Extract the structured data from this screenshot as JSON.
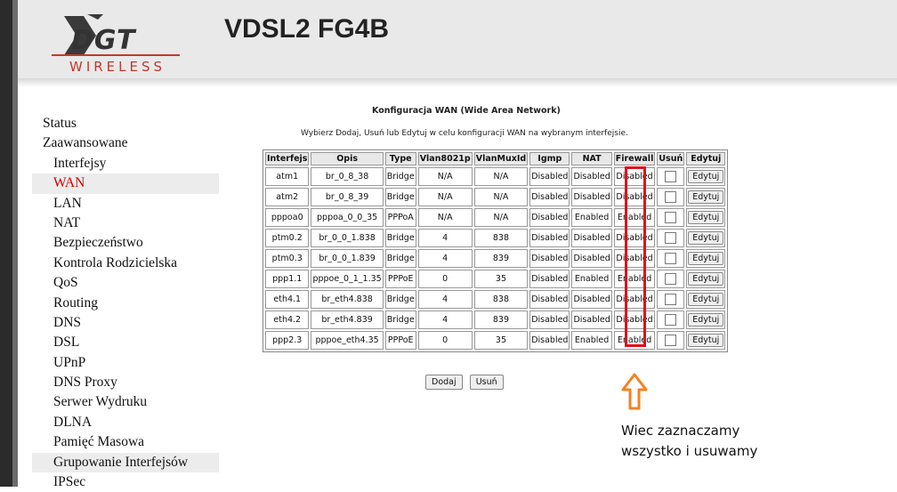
{
  "header": {
    "logo_main": "DGT",
    "logo_sub": "WIRELESS",
    "title": "VDSL2 FG4B"
  },
  "sidebar": {
    "items": [
      {
        "label": "Status",
        "level": "top"
      },
      {
        "label": "Zaawansowane",
        "level": "top"
      },
      {
        "label": "Interfejsy",
        "level": "sub"
      },
      {
        "label": "WAN",
        "level": "sub",
        "active": true
      },
      {
        "label": "LAN",
        "level": "sub"
      },
      {
        "label": "NAT",
        "level": "sub"
      },
      {
        "label": "Bezpieczeństwo",
        "level": "sub"
      },
      {
        "label": "Kontrola Rodzicielska",
        "level": "sub"
      },
      {
        "label": "QoS",
        "level": "sub"
      },
      {
        "label": "Routing",
        "level": "sub"
      },
      {
        "label": "DNS",
        "level": "sub"
      },
      {
        "label": "DSL",
        "level": "sub"
      },
      {
        "label": "UPnP",
        "level": "sub"
      },
      {
        "label": "DNS Proxy",
        "level": "sub"
      },
      {
        "label": "Serwer Wydruku",
        "level": "sub"
      },
      {
        "label": "DLNA",
        "level": "sub"
      },
      {
        "label": "Pamięć Masowa",
        "level": "sub"
      },
      {
        "label": "Grupowanie Interfejsów",
        "level": "sub",
        "highlight": true
      },
      {
        "label": "IPSec",
        "level": "sub"
      }
    ]
  },
  "main": {
    "title": "Konfiguracja WAN (Wide Area Network)",
    "description": "Wybierz Dodaj, Usuń lub Edytuj w celu konfiguracji WAN na wybranym interfejsie.",
    "table": {
      "headers": [
        "Interfejs",
        "Opis",
        "Type",
        "Vlan8021p",
        "VlanMuxId",
        "Igmp",
        "NAT",
        "Firewall",
        "Usuń",
        "Edytuj"
      ],
      "rows": [
        [
          "atm1",
          "br_0_8_38",
          "Bridge",
          "N/A",
          "N/A",
          "Disabled",
          "Disabled",
          "Disabled"
        ],
        [
          "atm2",
          "br_0_8_39",
          "Bridge",
          "N/A",
          "N/A",
          "Disabled",
          "Disabled",
          "Disabled"
        ],
        [
          "pppoa0",
          "pppoa_0_0_35",
          "PPPoA",
          "N/A",
          "N/A",
          "Disabled",
          "Enabled",
          "Enabled"
        ],
        [
          "ptm0.2",
          "br_0_0_1.838",
          "Bridge",
          "4",
          "838",
          "Disabled",
          "Disabled",
          "Disabled"
        ],
        [
          "ptm0.3",
          "br_0_0_1.839",
          "Bridge",
          "4",
          "839",
          "Disabled",
          "Disabled",
          "Disabled"
        ],
        [
          "ppp1.1",
          "pppoe_0_1_1.35",
          "PPPoE",
          "0",
          "35",
          "Disabled",
          "Enabled",
          "Enabled"
        ],
        [
          "eth4.1",
          "br_eth4.838",
          "Bridge",
          "4",
          "838",
          "Disabled",
          "Disabled",
          "Disabled"
        ],
        [
          "eth4.2",
          "br_eth4.839",
          "Bridge",
          "4",
          "839",
          "Disabled",
          "Disabled",
          "Disabled"
        ],
        [
          "ppp2.3",
          "pppoe_eth4.35",
          "PPPoE",
          "0",
          "35",
          "Disabled",
          "Enabled",
          "Enabled"
        ]
      ],
      "edit_label": "Edytuj"
    },
    "add_label": "Dodaj",
    "remove_label": "Usuń"
  },
  "annotation": {
    "line1": "Wiec zaznaczamy",
    "line2": "wszystko i usuwamy",
    "color": "#e0101a",
    "arrow_color": "#f58220"
  }
}
